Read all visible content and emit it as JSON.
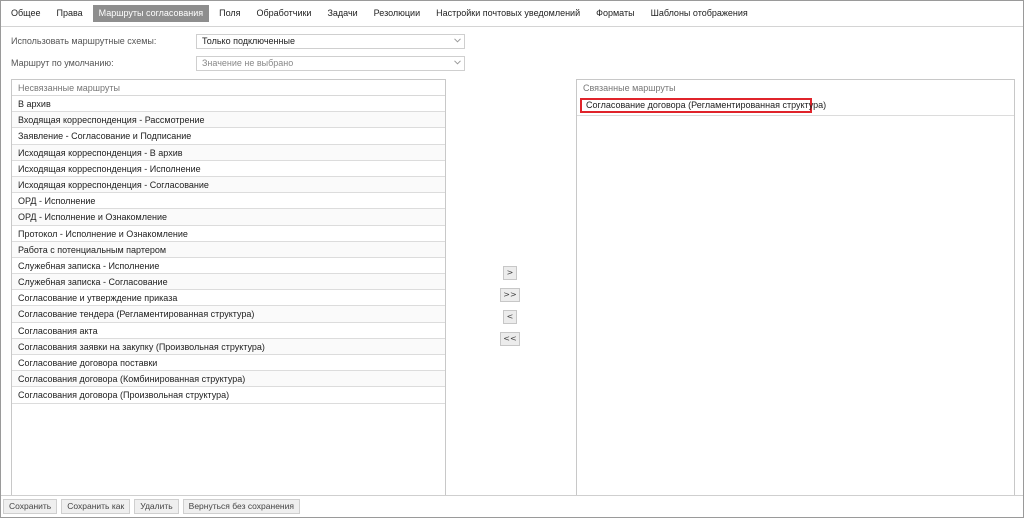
{
  "tabs": [
    {
      "label": "Общее",
      "active": false
    },
    {
      "label": "Права",
      "active": false
    },
    {
      "label": "Маршруты согласования",
      "active": true
    },
    {
      "label": "Поля",
      "active": false
    },
    {
      "label": "Обработчики",
      "active": false
    },
    {
      "label": "Задачи",
      "active": false
    },
    {
      "label": "Резолюции",
      "active": false
    },
    {
      "label": "Настройки почтовых уведомлений",
      "active": false
    },
    {
      "label": "Форматы",
      "active": false
    },
    {
      "label": "Шаблоны отображения",
      "active": false
    }
  ],
  "form": {
    "use_schemes_label": "Использовать маршрутные схемы:",
    "use_schemes_value": "Только подключенные",
    "default_route_label": "Маршрут по умолчанию:",
    "default_route_value": "Значение не выбрано"
  },
  "unlinked": {
    "header": "Несвязанные маршруты",
    "items": [
      "В архив",
      "Входящая корреспонденция - Рассмотрение",
      "Заявление - Согласование и Подписание",
      "Исходящая корреспонденция - В архив",
      "Исходящая корреспонденция - Исполнение",
      "Исходящая корреспонденция - Согласование",
      "ОРД - Исполнение",
      "ОРД - Исполнение и Ознакомление",
      "Протокол - Исполнение и Ознакомление",
      "Работа с потенциальным партером",
      "Служебная записка - Исполнение",
      "Служебная записка - Согласование",
      "Согласование и утверждение приказа",
      "Согласование тендера (Регламентированная структура)",
      "Согласования акта",
      "Согласования заявки на закупку (Произвольная структура)",
      "Согласование договора поставки",
      "Согласования договора (Комбинированная структура)",
      "Согласования договора (Произвольная структура)"
    ]
  },
  "linked": {
    "header": "Связанные маршруты",
    "items": [
      "Согласование договора (Регламентированная структура)"
    ],
    "highlight_color": "#e0242b"
  },
  "transfer": {
    "move_right": ">",
    "move_all_right": ">>",
    "move_left": "<",
    "move_all_left": "<<"
  },
  "footer": {
    "save": "Сохранить",
    "save_as": "Сохранить как",
    "delete": "Удалить",
    "back": "Вернуться без сохранения"
  },
  "icons": {
    "dropdown": "chevron-down-icon"
  },
  "colors": {
    "active_tab": "#8e8e8e",
    "border": "#c8c8c8"
  }
}
